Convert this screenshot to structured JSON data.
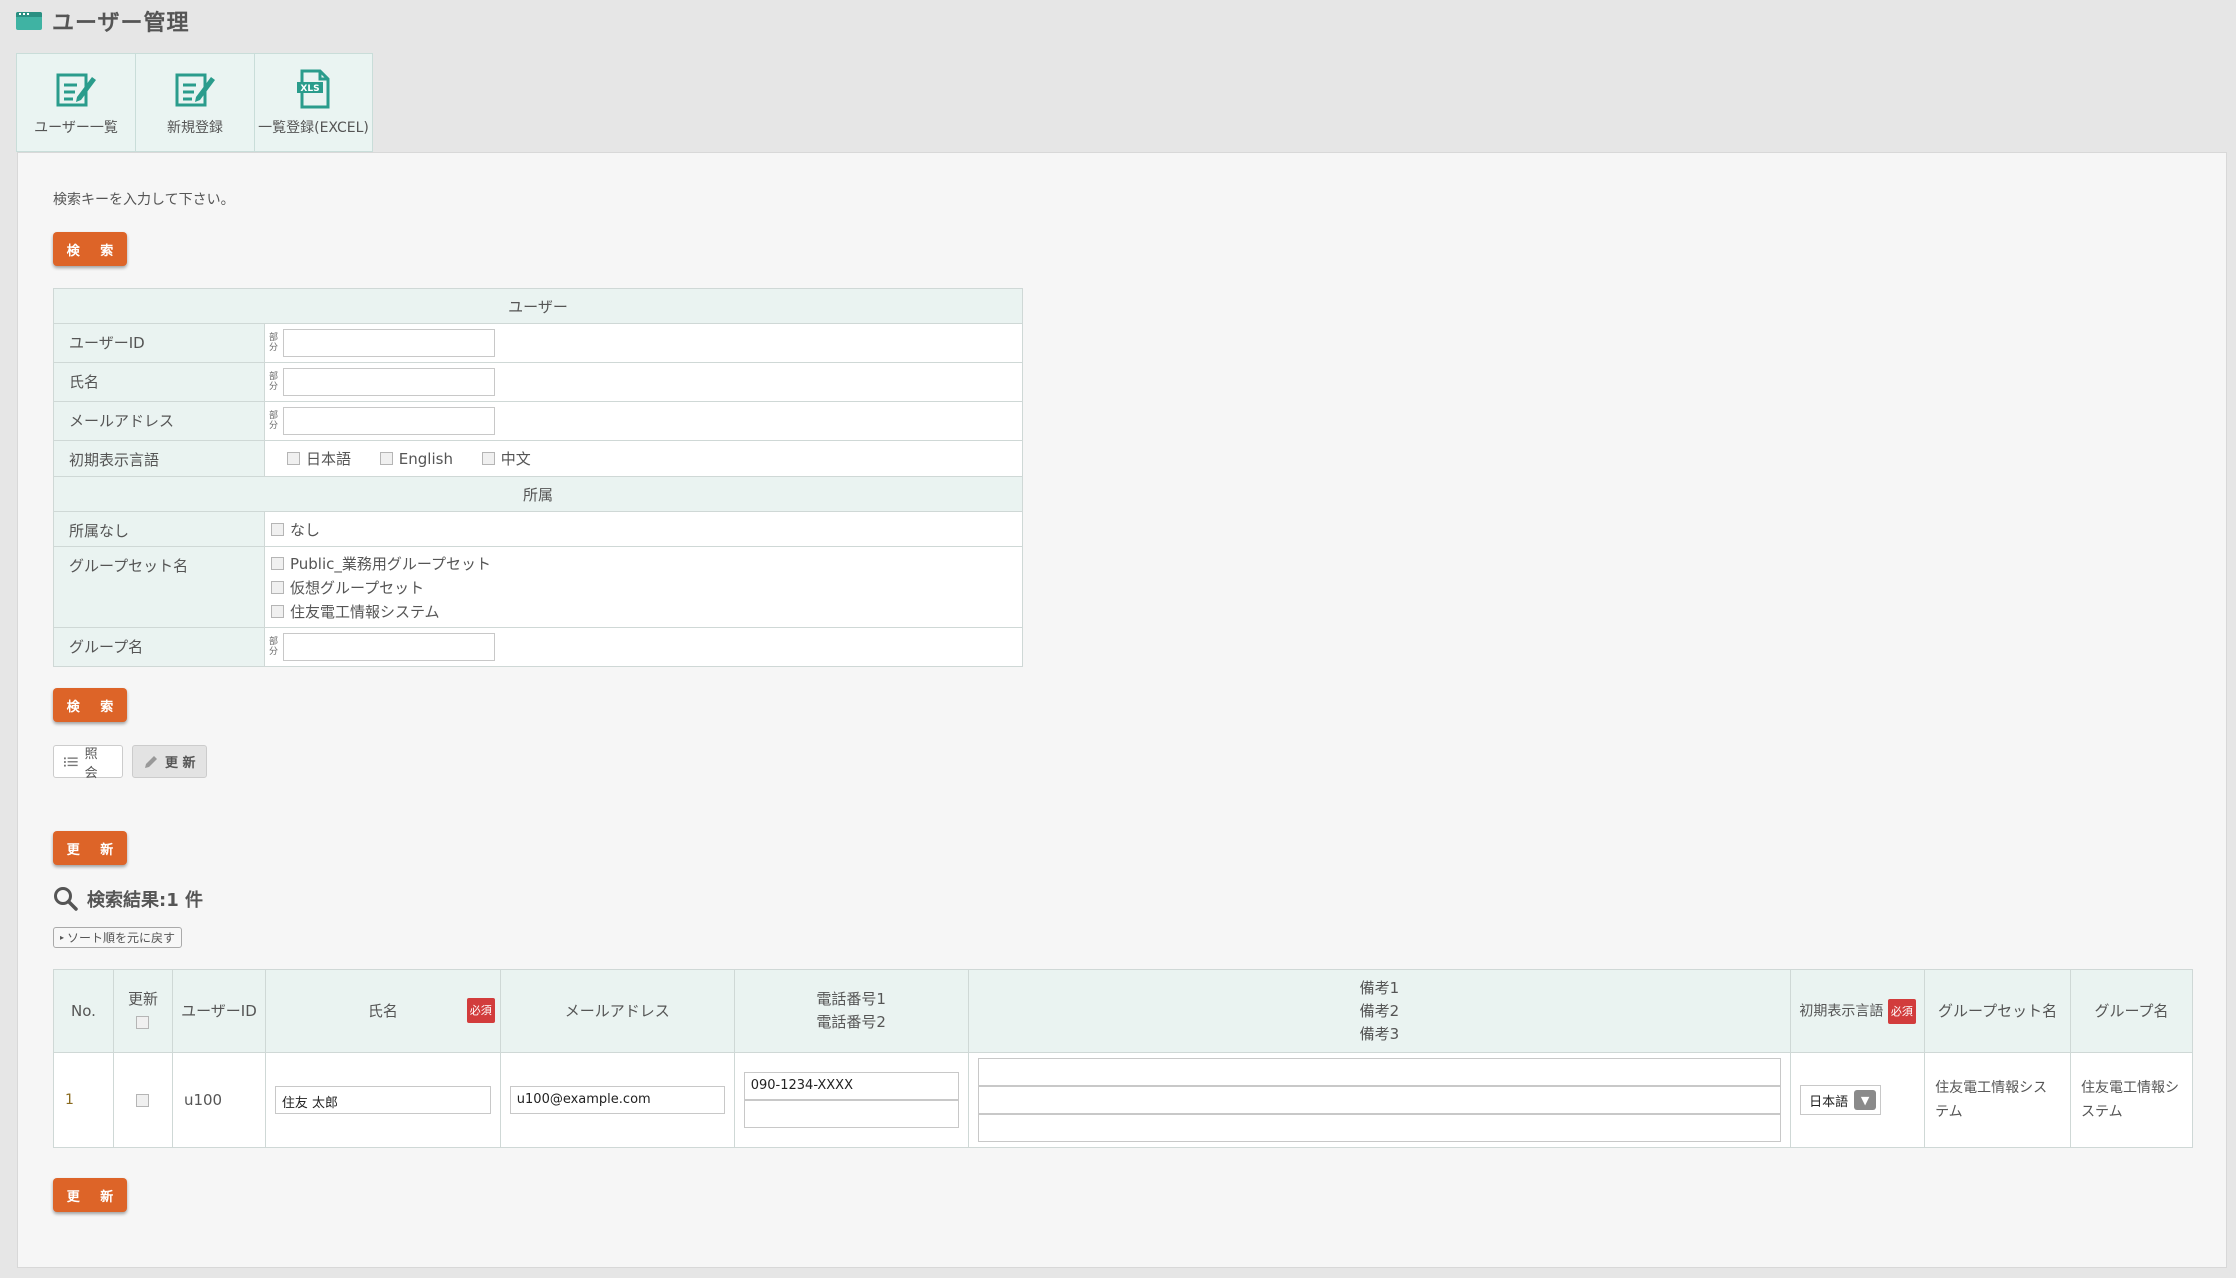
{
  "header": {
    "title": "ユーザー管理",
    "icon": "window-icon"
  },
  "tabs": [
    {
      "label": "ユーザー一覧",
      "icon": "edit-document-icon"
    },
    {
      "label": "新規登録",
      "icon": "edit-document-icon"
    },
    {
      "label": "一覧登録(EXCEL)",
      "icon": "xls-file-icon"
    }
  ],
  "search": {
    "instruction": "検索キーを入力して下さい。",
    "button_label": "検 索",
    "section_user": "ユーザー",
    "section_affiliation": "所属",
    "partial_marker": "部分",
    "fields": {
      "user_id": "ユーザーID",
      "name": "氏名",
      "email": "メールアドレス",
      "language": "初期表示言語",
      "no_affiliation": "所属なし",
      "groupset_name": "グループセット名",
      "group_name": "グループ名"
    },
    "language_options": [
      "日本語",
      "English",
      "中文"
    ],
    "no_affiliation_option": "なし",
    "groupset_options": [
      "Public_業務用グループセット",
      "仮想グループセット",
      "住友電工情報システム"
    ]
  },
  "mode": {
    "view_label": "照 会",
    "update_label": "更 新"
  },
  "update_button_label": "更 新",
  "results": {
    "title": "検索結果:1 件",
    "sort_reset": "ソート順を元に戻す",
    "required_badge": "必須",
    "columns": {
      "no": "No.",
      "update": "更新",
      "user_id": "ユーザーID",
      "name": "氏名",
      "email": "メールアドレス",
      "phone1": "電話番号1",
      "phone2": "電話番号2",
      "note1": "備考1",
      "note2": "備考2",
      "note3": "備考3",
      "language": "初期表示言語",
      "groupset": "グループセット名",
      "group": "グループ名"
    },
    "rows": [
      {
        "no": "1",
        "user_id": "u100",
        "name": "住友 太郎",
        "email": "u100@example.com",
        "phone1": "090-1234-XXXX",
        "phone2": "",
        "language": "日本語",
        "groupset": "住友電工情報システム",
        "group": "住友電工情報システム"
      }
    ]
  },
  "colors": {
    "accent": "#dd6428",
    "teal": "#3fb3a3",
    "required": "#d23c3c",
    "header_bg": "#eaf3f1"
  }
}
